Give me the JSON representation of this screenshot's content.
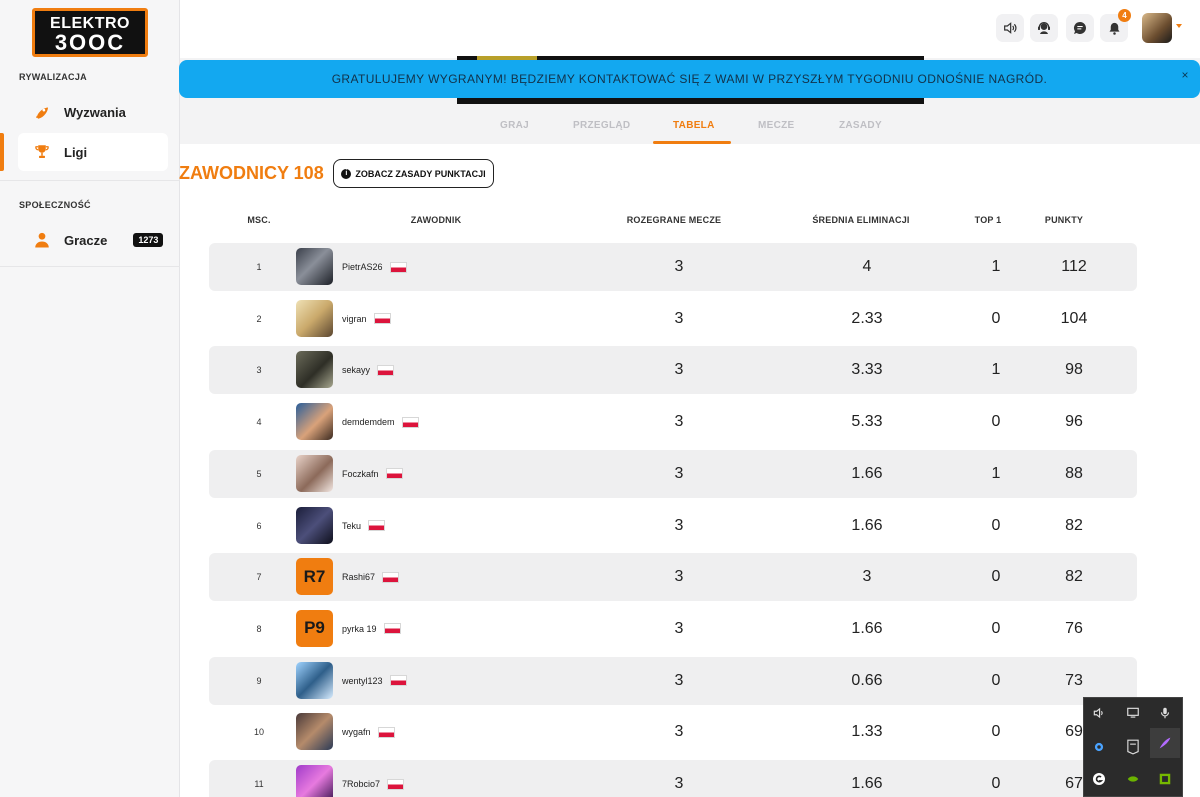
{
  "logo": {
    "line1": "ELEKTRO",
    "line2": "3OOC"
  },
  "sidebar": {
    "section1": "RYWALIZACJA",
    "section2": "SPOŁECZNOŚĆ",
    "items": [
      {
        "label": "Wyzwania",
        "icon": "rocket-icon"
      },
      {
        "label": "Ligi",
        "icon": "trophy-icon",
        "active": true
      },
      {
        "label": "Gracze",
        "icon": "user-icon",
        "badge": "1273"
      }
    ]
  },
  "header": {
    "notifications_count": "4"
  },
  "banner": {
    "text": "GRATULUJEMY WYGRANYM! BĘDZIEMY KONTAKTOWAĆ SIĘ Z WAMI W PRZYSZŁYM TYGODNIU ODNOŚNIE NAGRÓD.",
    "close": "×"
  },
  "tabs": [
    "GRAJ",
    "PRZEGLĄD",
    "TABELA",
    "MECZE",
    "ZASADY"
  ],
  "active_tab": "TABELA",
  "players": {
    "title": "ZAWODNICY 108",
    "rules_button": "ZOBACZ ZASADY PUNKTACJI",
    "info_glyph": "i"
  },
  "table": {
    "headers": [
      "MSC.",
      "ZAWODNIK",
      "ROZEGRANE MECZE",
      "ŚREDNIA ELIMINACJI",
      "TOP 1",
      "PUNKTY"
    ],
    "rows": [
      {
        "rank": "1",
        "name": "PietrAS26",
        "mecze": "3",
        "srednia": "4",
        "top1": "1",
        "punkty": "112"
      },
      {
        "rank": "2",
        "name": "vigran",
        "mecze": "3",
        "srednia": "2.33",
        "top1": "0",
        "punkty": "104"
      },
      {
        "rank": "3",
        "name": "sekayy",
        "mecze": "3",
        "srednia": "3.33",
        "top1": "1",
        "punkty": "98"
      },
      {
        "rank": "4",
        "name": "demdemdem",
        "mecze": "3",
        "srednia": "5.33",
        "top1": "0",
        "punkty": "96"
      },
      {
        "rank": "5",
        "name": "Foczkafn",
        "mecze": "3",
        "srednia": "1.66",
        "top1": "1",
        "punkty": "88"
      },
      {
        "rank": "6",
        "name": "Teku",
        "mecze": "3",
        "srednia": "1.66",
        "top1": "0",
        "punkty": "82"
      },
      {
        "rank": "7",
        "name": "Rashi67",
        "avatar_text": "R7",
        "mecze": "3",
        "srednia": "3",
        "top1": "0",
        "punkty": "82"
      },
      {
        "rank": "8",
        "name": "pyrka 19",
        "avatar_text": "P9",
        "mecze": "3",
        "srednia": "1.66",
        "top1": "0",
        "punkty": "76"
      },
      {
        "rank": "9",
        "name": "wentyl123",
        "mecze": "3",
        "srednia": "0.66",
        "top1": "0",
        "punkty": "73"
      },
      {
        "rank": "10",
        "name": "wygafn",
        "mecze": "3",
        "srednia": "1.33",
        "top1": "0",
        "punkty": "69"
      },
      {
        "rank": "11",
        "name": "7Robcio7",
        "mecze": "3",
        "srednia": "1.66",
        "top1": "0",
        "punkty": "67"
      }
    ]
  },
  "colors": {
    "accent": "#f07d10",
    "banner": "#13a8f0",
    "row_shade": "#efeff0"
  }
}
